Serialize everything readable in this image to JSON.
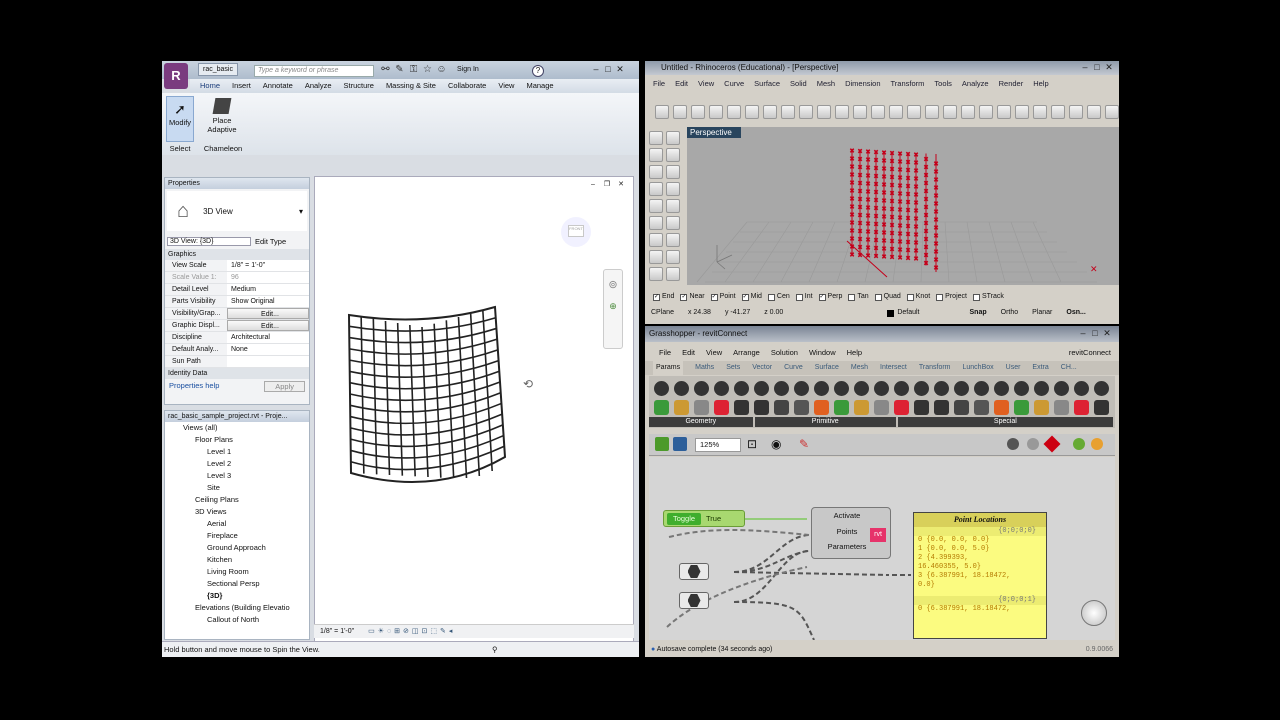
{
  "revit": {
    "file_tab": "rac_basic",
    "search_placeholder": "Type a keyword or phrase",
    "sign_in": "Sign In",
    "help": "?",
    "menu": [
      "Home",
      "Insert",
      "Annotate",
      "Analyze",
      "Structure",
      "Massing & Site",
      "Collaborate",
      "View",
      "Manage"
    ],
    "ribbon": {
      "modify": "Modify",
      "place_adaptive": "Place\nAdaptive",
      "group_select": "Select",
      "group_chameleon": "Chameleon"
    },
    "properties": {
      "title": "Properties",
      "type": "3D View",
      "selector": "3D View: {3D}",
      "edit_type": "Edit Type",
      "section": "Graphics",
      "rows": [
        {
          "k": "View Scale",
          "v": "1/8\" = 1'-0\""
        },
        {
          "k": "Scale Value  1:",
          "v": "96"
        },
        {
          "k": "Detail Level",
          "v": "Medium"
        },
        {
          "k": "Parts Visibility",
          "v": "Show Original"
        },
        {
          "k": "Visibility/Grap...",
          "v": "Edit..."
        },
        {
          "k": "Graphic Displ...",
          "v": "Edit..."
        },
        {
          "k": "Discipline",
          "v": "Architectural"
        },
        {
          "k": "Default Analy...",
          "v": "None"
        },
        {
          "k": "Sun Path",
          "v": ""
        }
      ],
      "identity": "Identity Data",
      "help_link": "Properties help",
      "apply": "Apply"
    },
    "browser": {
      "title": "rac_basic_sample_project.rvt - Proje...",
      "items": [
        {
          "t": "Views (all)",
          "l": 1
        },
        {
          "t": "Floor Plans",
          "l": 2
        },
        {
          "t": "Level 1",
          "l": 3
        },
        {
          "t": "Level 2",
          "l": 3
        },
        {
          "t": "Level 3",
          "l": 3
        },
        {
          "t": "Site",
          "l": 3
        },
        {
          "t": "Ceiling Plans",
          "l": 2
        },
        {
          "t": "3D Views",
          "l": 2
        },
        {
          "t": "Aerial",
          "l": 3
        },
        {
          "t": "Fireplace",
          "l": 3
        },
        {
          "t": "Ground Approach",
          "l": 3
        },
        {
          "t": "Kitchen",
          "l": 3
        },
        {
          "t": "Living Room",
          "l": 3
        },
        {
          "t": "Sectional Persp",
          "l": 3
        },
        {
          "t": "{3D}",
          "l": 3
        },
        {
          "t": "Elevations (Building Elevatio",
          "l": 2
        },
        {
          "t": "Callout of North",
          "l": 3
        }
      ]
    },
    "viewcube_label": "FRONT",
    "view_scale": "1/8\" = 1'-0\"",
    "status": "Hold button and move mouse to Spin the View."
  },
  "rhino": {
    "title": "Untitled - Rhinoceros (Educational) - [Perspective]",
    "menu": [
      "File",
      "Edit",
      "View",
      "Curve",
      "Surface",
      "Solid",
      "Mesh",
      "Dimension",
      "Transform",
      "Tools",
      "Analyze",
      "Render",
      "Help"
    ],
    "viewport": "Perspective",
    "osnaps": [
      {
        "n": "End",
        "c": true
      },
      {
        "n": "Near",
        "c": true
      },
      {
        "n": "Point",
        "c": true
      },
      {
        "n": "Mid",
        "c": true
      },
      {
        "n": "Cen",
        "c": false
      },
      {
        "n": "Int",
        "c": false
      },
      {
        "n": "Perp",
        "c": true
      },
      {
        "n": "Tan",
        "c": false
      },
      {
        "n": "Quad",
        "c": false
      },
      {
        "n": "Knot",
        "c": false
      },
      {
        "n": "Project",
        "c": false
      },
      {
        "n": "STrack",
        "c": false
      }
    ],
    "status": {
      "cplane": "CPlane",
      "x": "x 24.38",
      "y": "y -41.27",
      "z": "z 0.00",
      "layer": "Default",
      "snap": "Snap",
      "ortho": "Ortho",
      "planar": "Planar",
      "osnap": "Osn..."
    }
  },
  "grasshopper": {
    "title": "Grasshopper - revitConnect",
    "menu": [
      "File",
      "Edit",
      "View",
      "Arrange",
      "Solution",
      "Window",
      "Help"
    ],
    "document": "revitConnect",
    "tabs": [
      "Params",
      "Maths",
      "Sets",
      "Vector",
      "Curve",
      "Surface",
      "Mesh",
      "Intersect",
      "Transform",
      "LunchBox",
      "User",
      "Extra",
      "CH..."
    ],
    "groups": [
      "Geometry",
      "Primitive",
      "Special"
    ],
    "zoom": "125%",
    "toggle": {
      "label": "Toggle",
      "value": "True"
    },
    "component": {
      "inputs": [
        "Activate",
        "Points",
        "Parameters"
      ],
      "badge": "rvt"
    },
    "panel": {
      "title": "Point Locations",
      "header": "{0;0;0;0}",
      "rows": [
        "0 {0.0, 0.0, 0.0}",
        "1 {0.0, 0.0, 5.0}",
        "2 {4.399393,",
        "  16.460355, 5.0}",
        "3 {6.387991, 18.18472,",
        "  0.0}"
      ],
      "header2": "{0;0;0;1}",
      "row_last": "0 {6.387991, 18.18472,"
    },
    "status": "Autosave complete (34 seconds ago)",
    "version": "0.9.0066"
  },
  "colors": {
    "revit_bg": "#d9dde3",
    "rhino_bg": "#d4d0c8",
    "wall_red": "#c4001a",
    "gh_panel": "#fbfb80",
    "gh_toggle": "#3fae2d"
  }
}
